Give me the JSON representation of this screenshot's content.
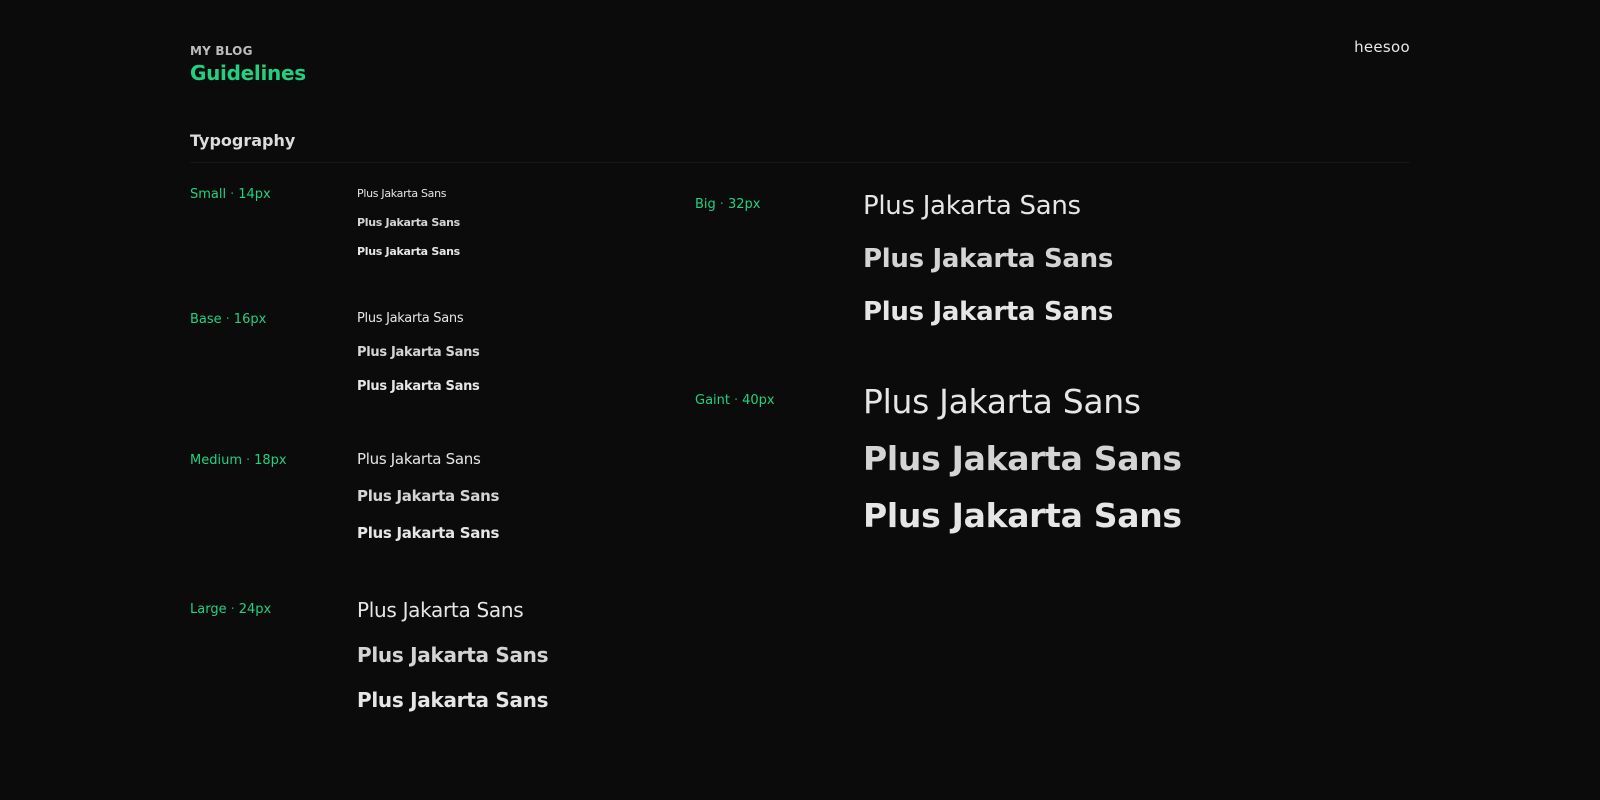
{
  "header": {
    "eyebrow": "MY BLOG",
    "title": "Guidelines",
    "brand": "heesoo"
  },
  "section": {
    "title": "Typography"
  },
  "sample_text": "Plus Jakarta Sans",
  "scales": [
    {
      "name": "Small",
      "size": "14px",
      "samples": [
        "Plus Jakarta Sans",
        "Plus Jakarta Sans",
        "Plus Jakarta Sans"
      ]
    },
    {
      "name": "Base",
      "size": "16px",
      "samples": [
        "Plus Jakarta Sans",
        "Plus Jakarta Sans",
        "Plus Jakarta Sans"
      ]
    },
    {
      "name": "Medium",
      "size": "18px",
      "samples": [
        "Plus Jakarta Sans",
        "Plus Jakarta Sans",
        "Plus Jakarta Sans"
      ]
    },
    {
      "name": "Large",
      "size": "24px",
      "samples": [
        "Plus Jakarta Sans",
        "Plus Jakarta Sans",
        "Plus Jakarta Sans"
      ]
    },
    {
      "name": "Big",
      "size": "32px",
      "samples": [
        "Plus Jakarta Sans",
        "Plus Jakarta Sans",
        "Plus Jakarta Sans"
      ]
    },
    {
      "name": "Gaint",
      "size": "40px",
      "samples": [
        "Plus Jakarta Sans",
        "Plus Jakarta Sans",
        "Plus Jakarta Sans"
      ]
    }
  ],
  "colors": {
    "background": "#0b0b0b",
    "accent": "#22d17f",
    "text": "#e6e6e6"
  }
}
